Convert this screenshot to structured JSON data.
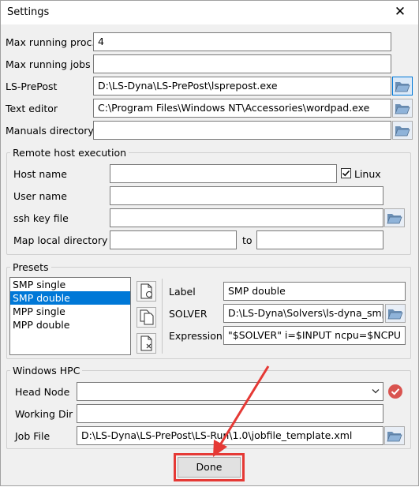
{
  "window": {
    "title": "Settings",
    "close_glyph": "✕"
  },
  "general": {
    "max_running_proc": {
      "label": "Max running proc.",
      "value": "4"
    },
    "max_running_jobs": {
      "label": "Max running jobs",
      "value": ""
    },
    "ls_prepost": {
      "label": "LS-PrePost",
      "value": "D:\\LS-Dyna\\LS-PrePost\\lsprepost.exe"
    },
    "text_editor": {
      "label": "Text editor",
      "value": "C:\\Program Files\\Windows NT\\Accessories\\wordpad.exe"
    },
    "manuals_directory": {
      "label": "Manuals directory",
      "value": ""
    }
  },
  "remote": {
    "title": "Remote host execution",
    "host_name": {
      "label": "Host name",
      "value": ""
    },
    "linux": {
      "label": "Linux",
      "checked": true
    },
    "user_name": {
      "label": "User name",
      "value": ""
    },
    "ssh_key_file": {
      "label": "ssh key file",
      "value": ""
    },
    "map_local_directory": {
      "label": "Map local directory",
      "value": "",
      "to_label": "to",
      "to_value": ""
    }
  },
  "presets": {
    "title": "Presets",
    "items": [
      "SMP single",
      "SMP double",
      "MPP single",
      "MPP double"
    ],
    "selected_index": 1,
    "label": {
      "label": "Label",
      "value": "SMP double"
    },
    "solver": {
      "label": "SOLVER",
      "value": "D:\\LS-Dyna\\Solvers\\ls-dyna_smp_s"
    },
    "expression": {
      "label": "Expression",
      "value": "\"$SOLVER\" i=$INPUT ncpu=$NCPU me"
    }
  },
  "hpc": {
    "title": "Windows HPC",
    "head_node": {
      "label": "Head Node",
      "value": ""
    },
    "working_dir": {
      "label": "Working Dir",
      "value": ""
    },
    "job_file": {
      "label": "Job File",
      "value": "D:\\LS-Dyna\\LS-PrePost\\LS-Run\\1.0\\jobfile_template.xml"
    }
  },
  "done_label": "Done",
  "icons": {
    "folder": "folder-open-icon",
    "new_preset": "new-file-icon",
    "copy_preset": "copy-icon",
    "delete_preset": "delete-file-icon",
    "validate": "check-circle-icon",
    "dropdown": "chevron-down-icon"
  },
  "colors": {
    "selection": "#0078d7",
    "annotation_red": "#e53935",
    "validate_red": "#d9534f"
  }
}
